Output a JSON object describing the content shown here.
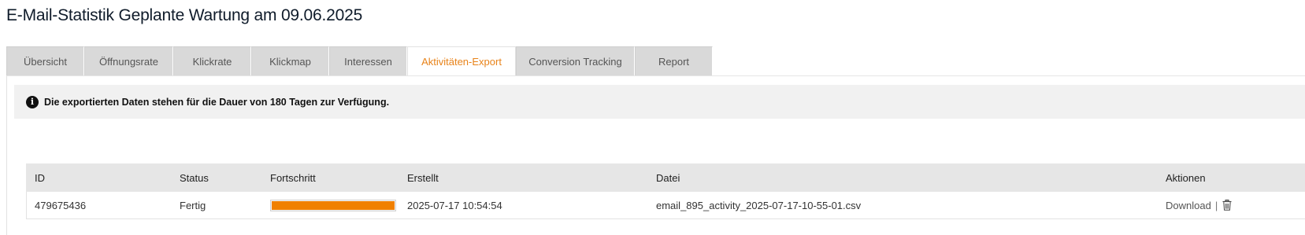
{
  "page": {
    "title": "E-Mail-Statistik Geplante Wartung am 09.06.2025"
  },
  "tabs": [
    {
      "label": "Übersicht",
      "active": false
    },
    {
      "label": "Öffnungsrate",
      "active": false
    },
    {
      "label": "Klickrate",
      "active": false
    },
    {
      "label": "Klickmap",
      "active": false
    },
    {
      "label": "Interessen",
      "active": false
    },
    {
      "label": "Aktivitäten-Export",
      "active": true
    },
    {
      "label": "Conversion Tracking",
      "active": false
    },
    {
      "label": "Report",
      "active": false
    }
  ],
  "info": {
    "icon": "info-icon",
    "text": "Die exportierten Daten stehen für die Dauer von 180 Tagen zur Verfügung."
  },
  "table": {
    "headers": {
      "id": "ID",
      "status": "Status",
      "progress": "Fortschritt",
      "created": "Erstellt",
      "file": "Datei",
      "actions": "Aktionen"
    },
    "rows": [
      {
        "id": "479675436",
        "status": "Fertig",
        "progress_percent": 100,
        "created": "2025-07-17 10:54:54",
        "file": "email_895_activity_2025-07-17-10-55-01.csv",
        "download_label": "Download",
        "separator": "|",
        "delete_icon": "trash-icon"
      }
    ]
  },
  "colors": {
    "accent": "#e8831a",
    "progress": "#f08000",
    "tab_inactive": "#d9d9d9",
    "info_bg": "#f1f1f1",
    "table_header_bg": "#e6e6e6"
  }
}
